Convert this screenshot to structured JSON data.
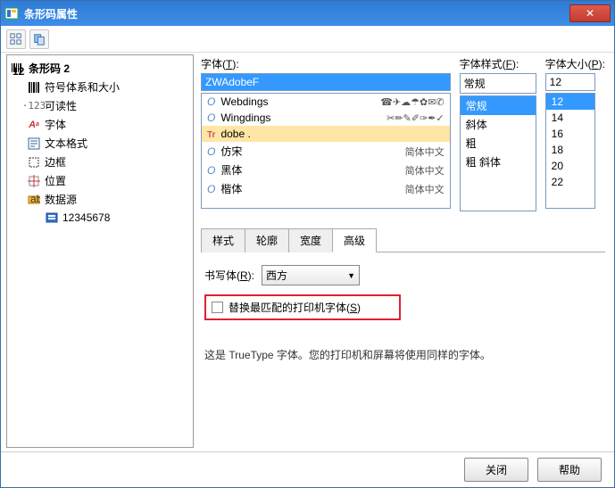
{
  "window": {
    "title": "条形码属性"
  },
  "tree": {
    "root": "条形码 2",
    "items": [
      "符号体系和大小",
      "可读性",
      "字体",
      "文本格式",
      "边框",
      "位置",
      "数据源"
    ],
    "dataSourceChild": "12345678"
  },
  "fontGroup": {
    "label_prefix": "字体(",
    "label_key": "T",
    "label_suffix": "):",
    "value": "ZWAdobeF",
    "list": [
      {
        "name": "Webdings",
        "sample": "☎✈☁☂✿✉✆"
      },
      {
        "name": "Wingdings",
        "sample": "✂✏✎✐✑✒✓"
      },
      {
        "name": "dobe .",
        "sample": ""
      },
      {
        "name": "仿宋",
        "sample": "简体中文"
      },
      {
        "name": "黑体",
        "sample": "简体中文"
      },
      {
        "name": "楷体",
        "sample": "简体中文"
      }
    ]
  },
  "styleGroup": {
    "label_prefix": "字体样式(",
    "label_key": "F",
    "label_suffix": "):",
    "value": "常规",
    "list": [
      "常规",
      "斜体",
      "粗",
      "粗 斜体"
    ]
  },
  "sizeGroup": {
    "label_prefix": "字体大小(",
    "label_key": "P",
    "label_suffix": "):",
    "value": "12",
    "list": [
      "12",
      "14",
      "16",
      "18",
      "20",
      "22"
    ]
  },
  "tabs": {
    "items": [
      "样式",
      "轮廓",
      "宽度",
      "高级"
    ],
    "activeIndex": 3
  },
  "advanced": {
    "script_label_prefix": "书写体(",
    "script_label_key": "R",
    "script_label_suffix": "):",
    "script_value": "西方",
    "checkbox_prefix": "替换最匹配的打印机字体(",
    "checkbox_key": "S",
    "checkbox_suffix": ")",
    "info": "这是 TrueType 字体。您的打印机和屏幕将使用同样的字体。"
  },
  "footer": {
    "close": "关闭",
    "help": "帮助"
  }
}
